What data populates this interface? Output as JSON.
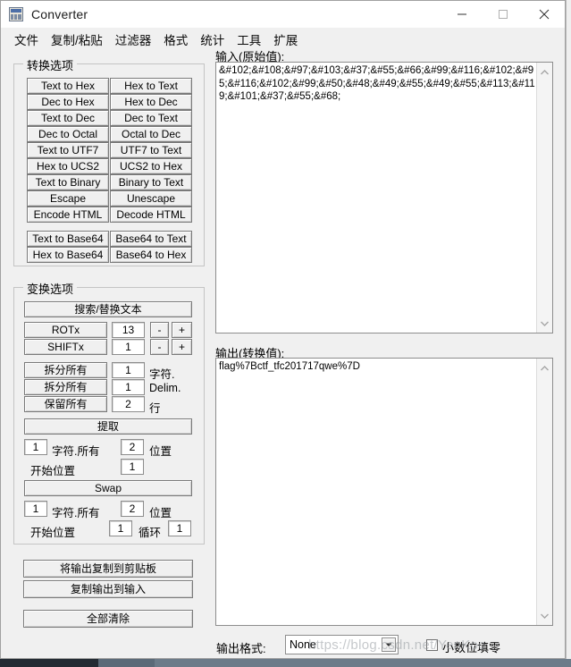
{
  "window": {
    "title": "Converter",
    "icon": "calculator-icon",
    "minimize_label": "—",
    "maximize_label": "□",
    "close_label": "✕"
  },
  "menubar": {
    "items": [
      {
        "label": "文件"
      },
      {
        "label": "复制/粘贴"
      },
      {
        "label": "过滤器"
      },
      {
        "label": "格式"
      },
      {
        "label": "统计"
      },
      {
        "label": "工具"
      },
      {
        "label": "扩展"
      }
    ]
  },
  "convert_group": {
    "title": "转换选项",
    "rows": [
      {
        "left": "Text to Hex",
        "right": "Hex to Text"
      },
      {
        "left": "Dec to Hex",
        "right": "Hex to Dec"
      },
      {
        "left": "Text to Dec",
        "right": "Dec to Text"
      },
      {
        "left": "Dec to Octal",
        "right": "Octal to Dec"
      },
      {
        "left": "Text to UTF7",
        "right": "UTF7 to Text"
      },
      {
        "left": "Hex to UCS2",
        "right": "UCS2 to Hex"
      },
      {
        "left": "Text to Binary",
        "right": "Binary to Text"
      },
      {
        "left": "Escape",
        "right": "Unescape"
      },
      {
        "left": "Encode HTML",
        "right": "Decode HTML"
      }
    ],
    "base64_rows": [
      {
        "left": "Text to Base64",
        "right": "Base64 to Text"
      },
      {
        "left": "Hex to Base64",
        "right": "Base64 to Hex"
      }
    ]
  },
  "transform_group": {
    "title": "变换选项",
    "search_replace_label": "搜索/替换文本",
    "rot": {
      "button": "ROTx",
      "value": "13",
      "minus": "-",
      "plus": "+"
    },
    "shift": {
      "button": "SHIFTx",
      "value": "1",
      "minus": "-",
      "plus": "+"
    },
    "split_rows": [
      {
        "button": "拆分所有",
        "value": "1",
        "unit": "字符."
      },
      {
        "button": "拆分所有",
        "value": "1",
        "unit": "Delim."
      },
      {
        "button": "保留所有",
        "value": "2",
        "unit": "行"
      }
    ],
    "extract": {
      "button": "提取",
      "chars_value": "1",
      "chars_label": "字符.所有",
      "pos_value": "2",
      "pos_label": "位置",
      "start_label": "开始位置",
      "start_value": "1"
    },
    "swap": {
      "button": "Swap",
      "chars_value": "1",
      "chars_label": "字符.所有",
      "pos_value": "2",
      "pos_label": "位置",
      "start_label": "开始位置",
      "start_value": "1",
      "loop_label": "循环",
      "loop_value": "1"
    }
  },
  "actions": {
    "copy_output_to_clipboard": "将输出复制到剪贴板",
    "copy_output_to_input": "复制输出到输入",
    "clear_all": "全部清除"
  },
  "input_area": {
    "label": "输入(原始值):",
    "value": "&#102;&#108;&#97;&#103;&#37;&#55;&#66;&#99;&#116;&#102;&#95;&#116;&#102;&#99;&#50;&#48;&#49;&#55;&#49;&#55;&#113;&#119;&#101;&#37;&#55;&#68;"
  },
  "output_area": {
    "label": "输出(转换值):",
    "value": "flag%7Bctf_tfc201717qwe%7D"
  },
  "bottom_bar": {
    "format_label": "输出格式:",
    "format_value": "None",
    "pad_decimals_label": "小数位填零",
    "pad_decimals_checked": false
  },
  "watermark": {
    "text": "https://blog.csdn.net/YenKoc"
  }
}
